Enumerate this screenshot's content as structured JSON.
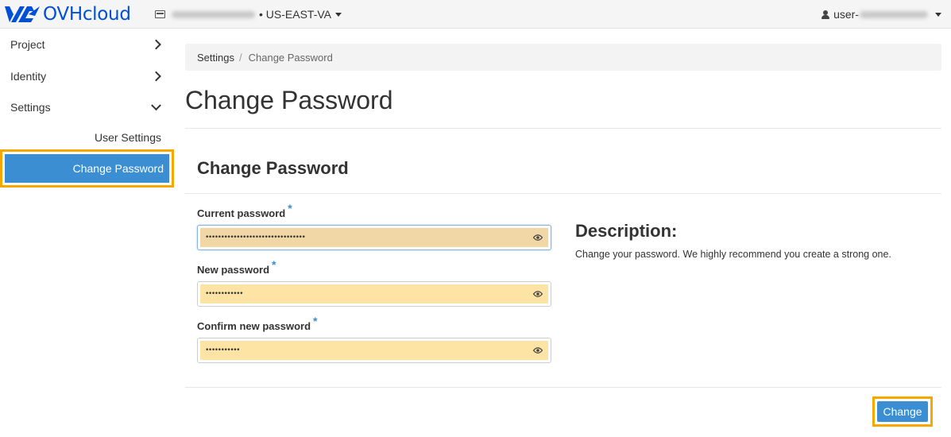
{
  "brand": {
    "name": "OVHcloud"
  },
  "header": {
    "region_label": "• US-EAST-VA",
    "user_prefix": "user-"
  },
  "sidebar": {
    "items": [
      {
        "label": "Project"
      },
      {
        "label": "Identity"
      },
      {
        "label": "Settings"
      }
    ],
    "sub_items": [
      {
        "label": "User Settings"
      },
      {
        "label": "Change Password"
      }
    ]
  },
  "breadcrumb": {
    "parent": "Settings",
    "separator": "/",
    "current": "Change Password"
  },
  "page": {
    "title": "Change Password"
  },
  "form": {
    "title": "Change Password",
    "fields": [
      {
        "label": "Current password",
        "value": "••••••••••••••••••••••••••••••••"
      },
      {
        "label": "New password",
        "value": "••••••••••••"
      },
      {
        "label": "Confirm new password",
        "value": "•••••••••••"
      }
    ],
    "required_mark": "*",
    "submit_label": "Change"
  },
  "description": {
    "title": "Description:",
    "text": "Change your password. We highly recommend you create a strong one."
  },
  "colors": {
    "brand": "#0050d7",
    "primary": "#3a8ed1",
    "highlight": "#f7a800",
    "autofill": "#fee4a4"
  }
}
